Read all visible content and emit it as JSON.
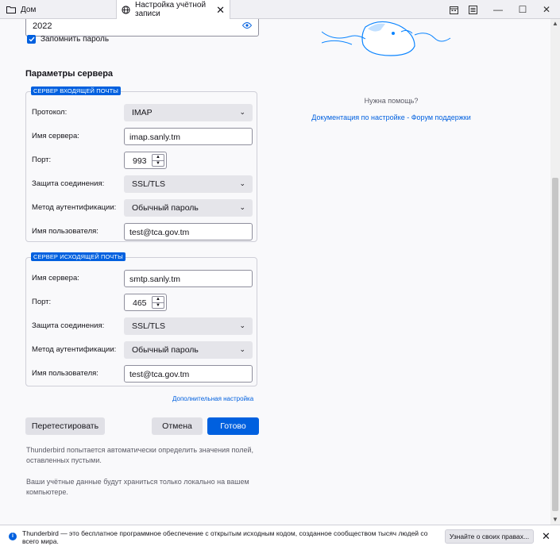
{
  "tabs": [
    {
      "label": "Дом",
      "icon": "folder-icon"
    },
    {
      "label": "Настройка учётной записи",
      "icon": "globe-icon",
      "close": "✕"
    }
  ],
  "window_controls": {
    "minimize": "—",
    "maximize": "☐",
    "close": "✕"
  },
  "password": {
    "value": "2022"
  },
  "remember_password": {
    "label": "Запомнить пароль",
    "checked": true
  },
  "server_params": {
    "title": "Параметры сервера"
  },
  "incoming": {
    "badge": "СЕРВЕР ВХОДЯЩЕЙ ПОЧТЫ",
    "protocol_label": "Протокол:",
    "protocol_value": "IMAP",
    "server_label": "Имя сервера:",
    "server_value": "imap.sanly.tm",
    "port_label": "Порт:",
    "port_value": "993",
    "security_label": "Защита соединения:",
    "security_value": "SSL/TLS",
    "auth_label": "Метод аутентификации:",
    "auth_value": "Обычный пароль",
    "user_label": "Имя пользователя:",
    "user_value": "test@tca.gov.tm"
  },
  "outgoing": {
    "badge": "СЕРВЕР ИСХОДЯЩЕЙ ПОЧТЫ",
    "server_label": "Имя сервера:",
    "server_value": "smtp.sanly.tm",
    "port_label": "Порт:",
    "port_value": "465",
    "security_label": "Защита соединения:",
    "security_value": "SSL/TLS",
    "auth_label": "Метод аутентификации:",
    "auth_value": "Обычный пароль",
    "user_label": "Имя пользователя:",
    "user_value": "test@tca.gov.tm"
  },
  "advanced_link": "Дополнительная настройка",
  "buttons": {
    "retest": "Перетестировать",
    "cancel": "Отмена",
    "done": "Готово"
  },
  "notes": [
    "Thunderbird попытается автоматически определить значения полей, оставленных пустыми.",
    "Ваши учётные данные будут храниться только локально на вашем компьютере."
  ],
  "help": {
    "title": "Нужна помощь?",
    "links": "Документация по настройке - Форум поддержки"
  },
  "notification": {
    "text": "Thunderbird — это бесплатное программное обеспечение с открытым исходным кодом, созданное сообществом тысяч людей со всего мира.",
    "button": "Узнайте о своих правах...",
    "close": "✕"
  },
  "colors": {
    "accent": "#0060df",
    "background": "#f9f9fb"
  }
}
